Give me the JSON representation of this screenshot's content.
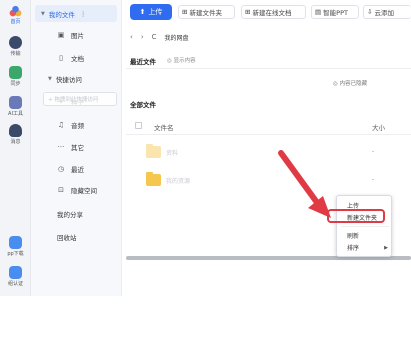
{
  "rail": {
    "items": [
      {
        "label": "首页",
        "icon": "app-logo-icon"
      },
      {
        "label": "传输",
        "icon": "transfer-icon"
      },
      {
        "label": "同步",
        "icon": "sync-icon"
      },
      {
        "label": "AI工具",
        "icon": "ai-tools-icon"
      },
      {
        "label": "消息",
        "icon": "message-icon"
      },
      {
        "label": "pp下载",
        "icon": "app-download-icon"
      },
      {
        "label": "组认证",
        "icon": "certification-icon"
      }
    ]
  },
  "sidebar": {
    "my_files": "我的文件",
    "items": [
      {
        "label": "图片",
        "icon": "image-icon"
      },
      {
        "label": "文档",
        "icon": "document-icon"
      }
    ],
    "quick_access": "快捷访问",
    "quick_placeholder": "+ 拖拽到此快捷访问",
    "items2": [
      {
        "label": "种子",
        "icon": "seed-icon"
      },
      {
        "label": "音频",
        "icon": "audio-icon"
      },
      {
        "label": "其它",
        "icon": "more-icon"
      },
      {
        "label": "最近",
        "icon": "clock-icon"
      },
      {
        "label": "隐藏空间",
        "icon": "hidden-space-icon"
      }
    ],
    "my_share": "我的分享",
    "recycle": "回收站"
  },
  "toolbar": {
    "upload": "上传",
    "new_folder": "新建文件夹",
    "new_online_doc": "新建在线文档",
    "smart_ppt": "智能PPT",
    "cloud_add": "云添加"
  },
  "nav": {
    "back": "‹",
    "forward": "›",
    "refresh": "C",
    "path": "我的网盘"
  },
  "main": {
    "recent_title": "最近文件",
    "show_content": "显示内容",
    "hidden_note": "内容已隐藏",
    "all_files_title": "全部文件",
    "col_filename": "文件名",
    "col_size": "大小",
    "files": [
      {
        "name": "资料",
        "size": "-"
      },
      {
        "name": "我的资源",
        "size": "-"
      }
    ]
  },
  "context_menu": {
    "items": [
      "上传",
      "新建文件夹",
      "刷新",
      "排序"
    ],
    "submenu_arrow": "▶"
  },
  "colors": {
    "accent": "#2f6cf0",
    "annotation": "#e03a45",
    "folder": "#f5c74e"
  }
}
